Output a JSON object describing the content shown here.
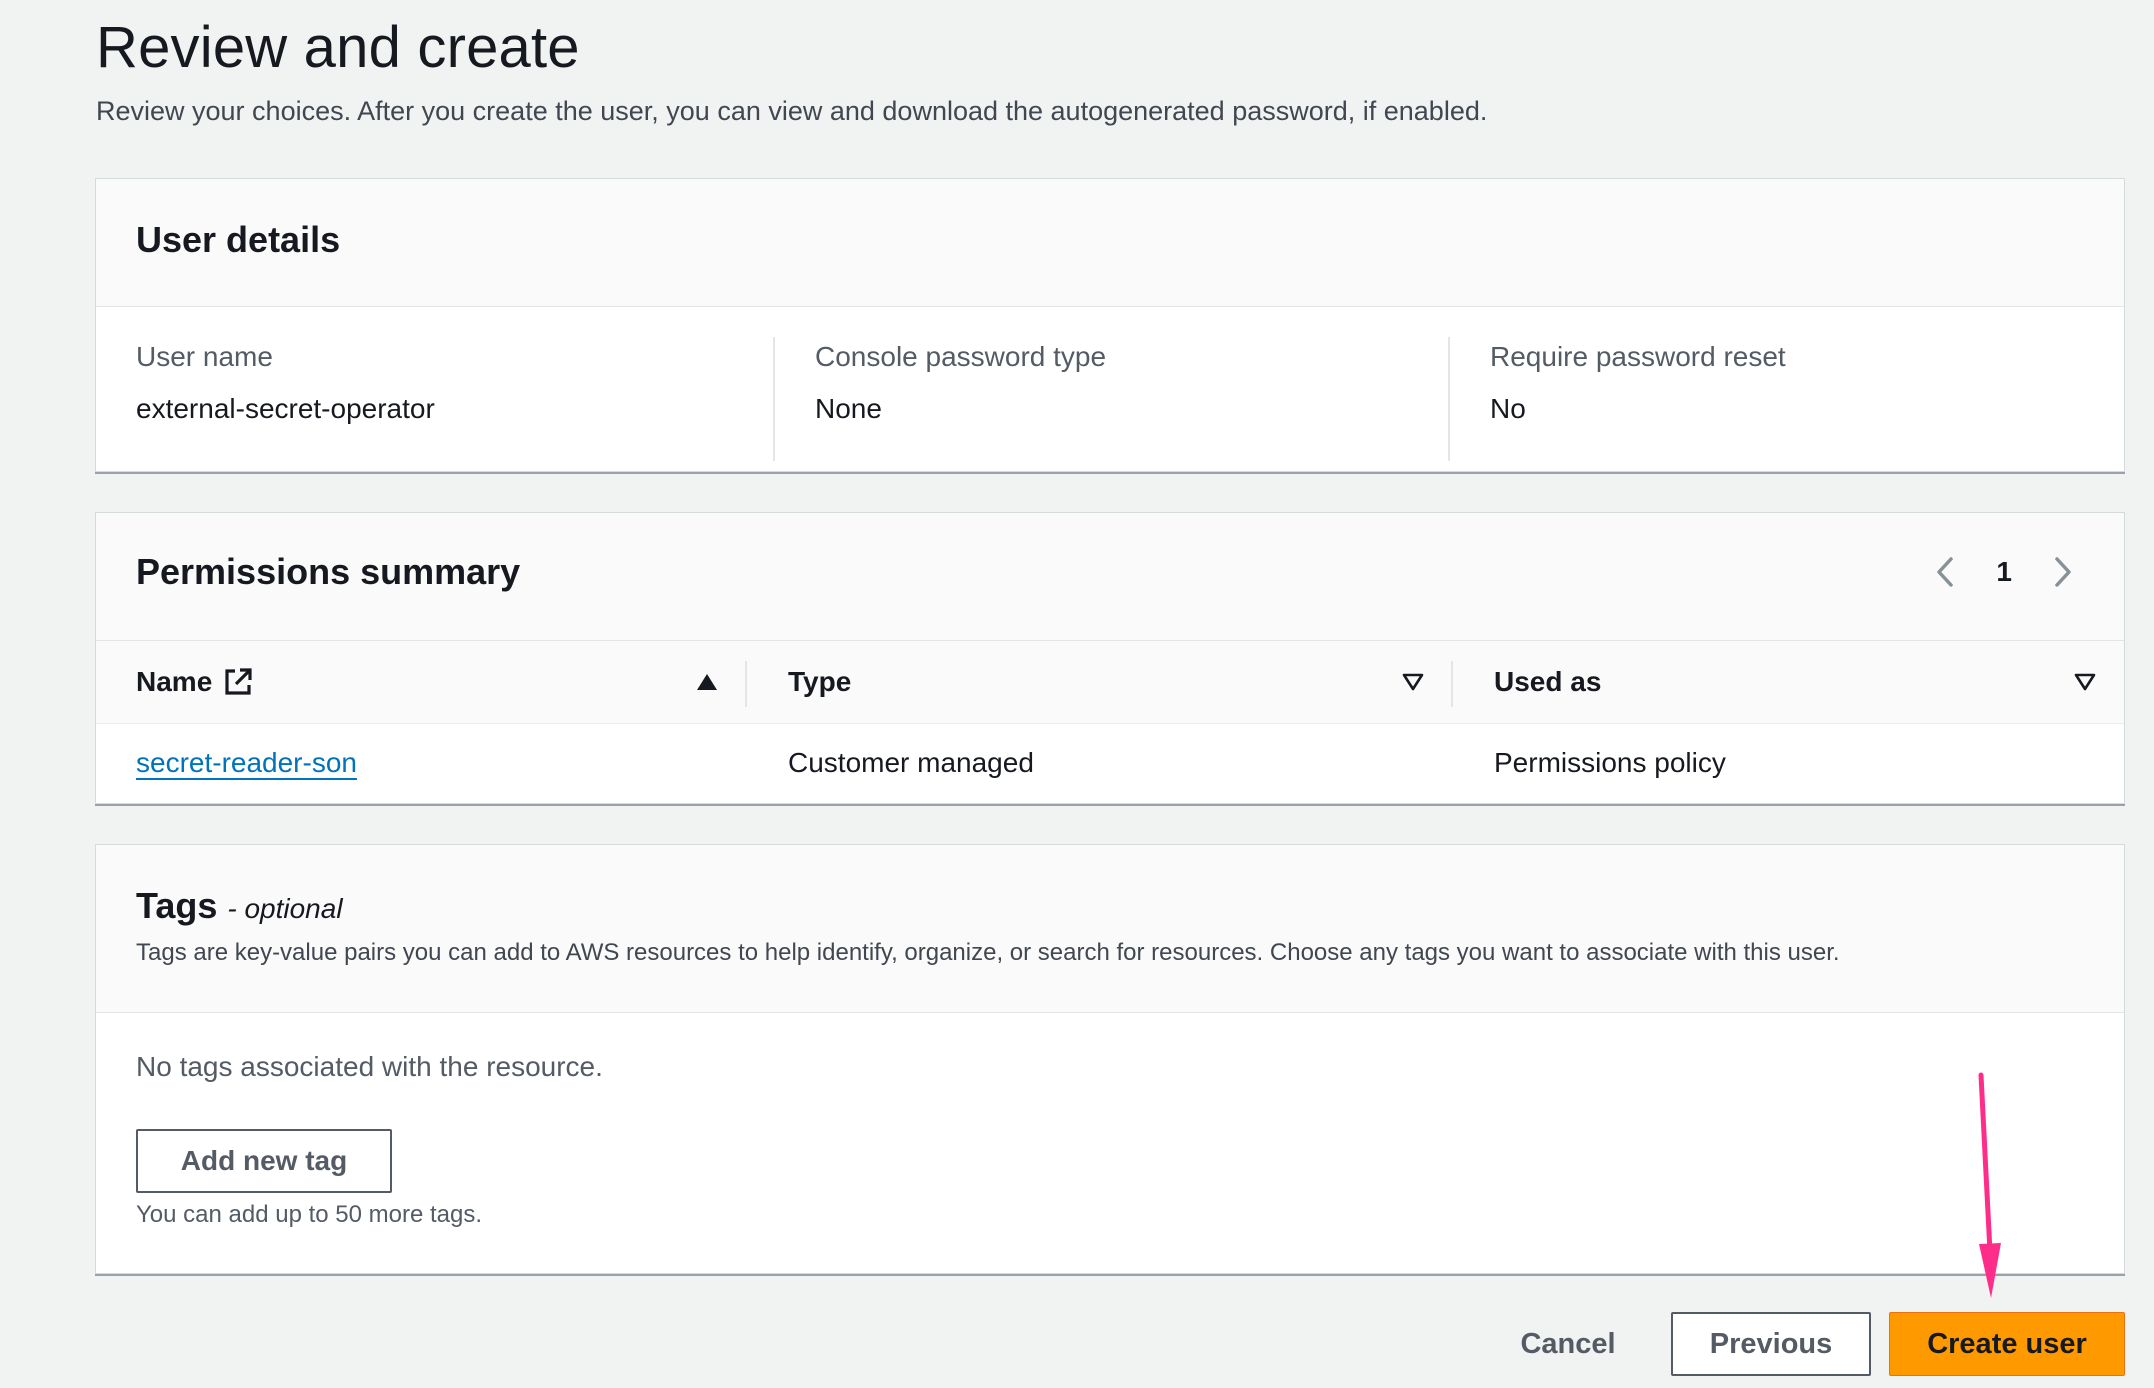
{
  "page": {
    "title": "Review and create",
    "description": "Review your choices. After you create the user, you can view and download the autogenerated password, if enabled."
  },
  "user_details": {
    "heading": "User details",
    "fields": [
      {
        "label": "User name",
        "value": "external-secret-operator"
      },
      {
        "label": "Console password type",
        "value": "None"
      },
      {
        "label": "Require password reset",
        "value": "No"
      }
    ]
  },
  "permissions_summary": {
    "heading": "Permissions summary",
    "pagination": {
      "current_page": "1"
    },
    "columns": [
      {
        "label": "Name",
        "sort": "ascending",
        "icon": "external-link-icon"
      },
      {
        "label": "Type",
        "sort": "unsorted"
      },
      {
        "label": "Used as",
        "sort": "unsorted"
      }
    ],
    "rows": [
      {
        "name": "secret-reader-son",
        "type": "Customer managed",
        "used_as": "Permissions policy"
      }
    ]
  },
  "tags": {
    "heading": "Tags",
    "optional_label": "- optional",
    "description": "Tags are key-value pairs you can add to AWS resources to help identify, organize, or search for resources. Choose any tags you want to associate with this user.",
    "empty_message": "No tags associated with the resource.",
    "add_button": "Add new tag",
    "hint": "You can add up to 50 more tags."
  },
  "footer": {
    "cancel": "Cancel",
    "previous": "Previous",
    "create": "Create user"
  },
  "colors": {
    "primary_button": "#ff9900",
    "link": "#0073bb",
    "annotation_arrow": "#ff2d8a",
    "background": "#f1f2f2"
  }
}
